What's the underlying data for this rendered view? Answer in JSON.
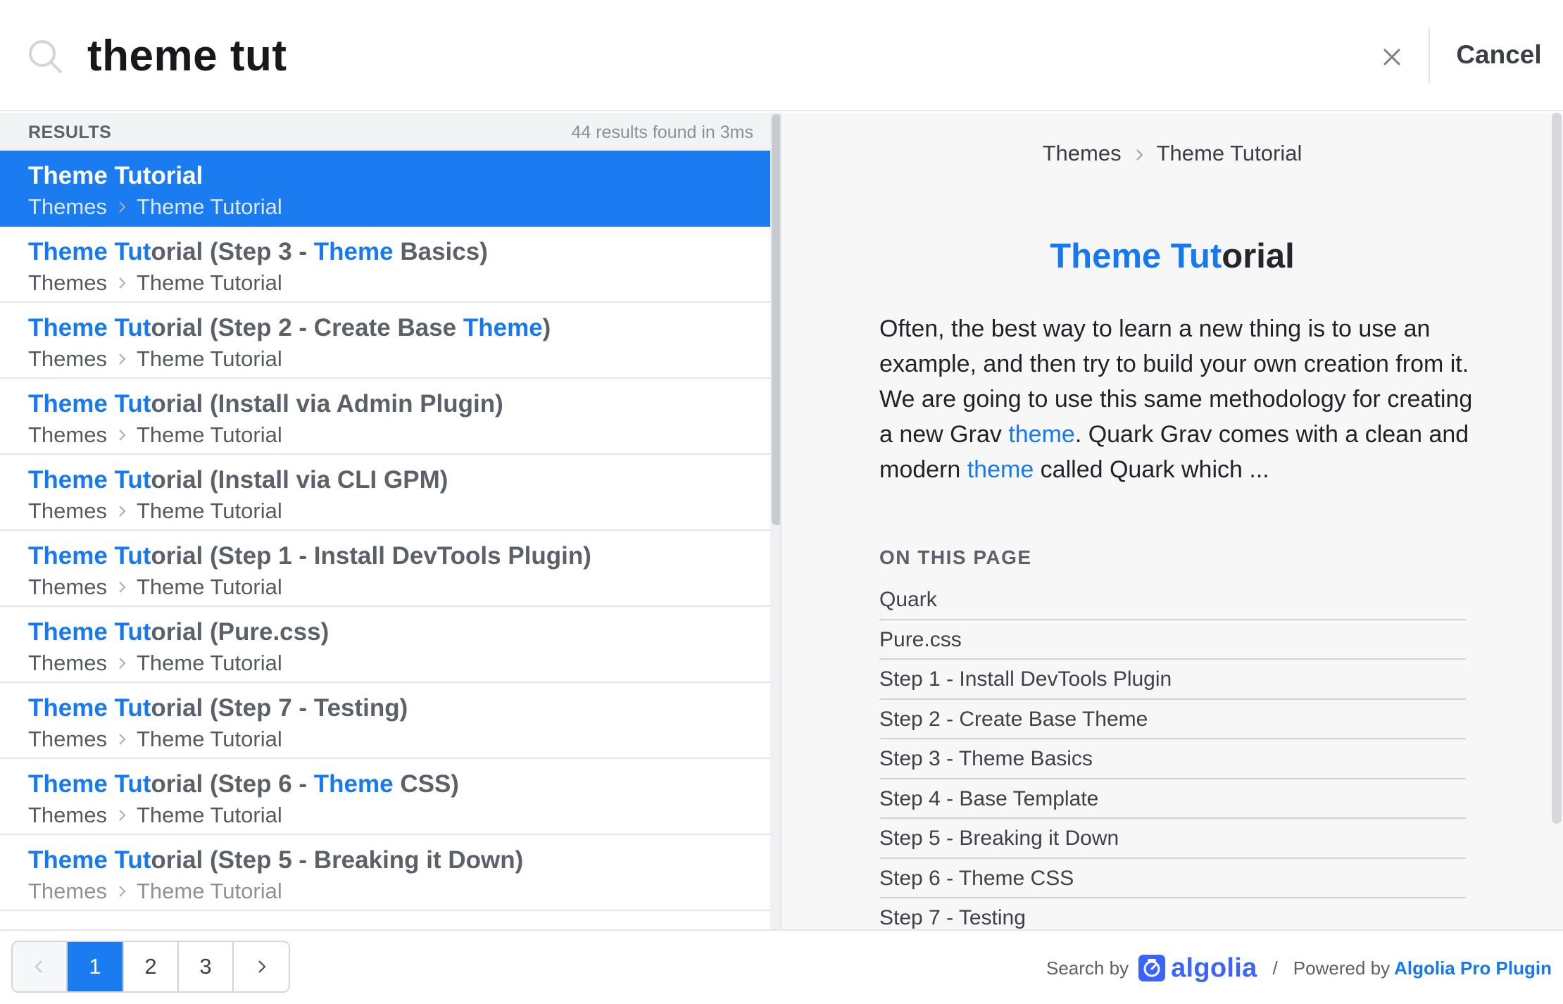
{
  "search": {
    "query": "theme tut",
    "cancel_label": "Cancel"
  },
  "results": {
    "header_label": "RESULTS",
    "meta": "44 results found in 3ms",
    "items": [
      {
        "title_hl": "Theme Tut",
        "title_rest": "orial",
        "title_tail": [],
        "crumb_1": "Themes",
        "crumb_2": "Theme Tutorial"
      },
      {
        "title_hl": "Theme Tut",
        "title_rest": "orial (Step 3 - ",
        "title_tail": [
          {
            "text": "Theme",
            "hl": true
          },
          {
            "text": " Basics)",
            "hl": false
          }
        ],
        "crumb_1": "Themes",
        "crumb_2": "Theme Tutorial"
      },
      {
        "title_hl": "Theme Tut",
        "title_rest": "orial (Step 2 - Create Base ",
        "title_tail": [
          {
            "text": "Theme",
            "hl": true
          },
          {
            "text": ")",
            "hl": false
          }
        ],
        "crumb_1": "Themes",
        "crumb_2": "Theme Tutorial"
      },
      {
        "title_hl": "Theme Tut",
        "title_rest": "orial (Install via Admin Plugin)",
        "title_tail": [],
        "crumb_1": "Themes",
        "crumb_2": "Theme Tutorial"
      },
      {
        "title_hl": "Theme Tut",
        "title_rest": "orial (Install via CLI GPM)",
        "title_tail": [],
        "crumb_1": "Themes",
        "crumb_2": "Theme Tutorial"
      },
      {
        "title_hl": "Theme Tut",
        "title_rest": "orial (Step 1 - Install DevTools Plugin)",
        "title_tail": [],
        "crumb_1": "Themes",
        "crumb_2": "Theme Tutorial"
      },
      {
        "title_hl": "Theme Tut",
        "title_rest": "orial (Pure.css)",
        "title_tail": [],
        "crumb_1": "Themes",
        "crumb_2": "Theme Tutorial"
      },
      {
        "title_hl": "Theme Tut",
        "title_rest": "orial (Step 7 - Testing)",
        "title_tail": [],
        "crumb_1": "Themes",
        "crumb_2": "Theme Tutorial"
      },
      {
        "title_hl": "Theme Tut",
        "title_rest": "orial (Step 6 - ",
        "title_tail": [
          {
            "text": "Theme",
            "hl": true
          },
          {
            "text": " CSS)",
            "hl": false
          }
        ],
        "crumb_1": "Themes",
        "crumb_2": "Theme Tutorial"
      },
      {
        "title_hl": "Theme Tut",
        "title_rest": "orial (Step 5 - Breaking it Down)",
        "title_tail": [],
        "crumb_1": "Themes",
        "crumb_2": "Theme Tutorial"
      }
    ]
  },
  "preview": {
    "crumb_1": "Themes",
    "crumb_2": "Theme Tutorial",
    "title_hl": "Theme Tut",
    "title_rest": "orial",
    "desc_1": "Often, the best way to learn a new thing is to use an example, and then try to build your own creation from it. We are going to use this same methodology for creating a new Grav ",
    "desc_link_1": "theme",
    "desc_2": ". Quark Grav comes with a clean and modern ",
    "desc_link_2": "theme",
    "desc_3": " called Quark which ...",
    "toc_title": "ON THIS PAGE",
    "toc": [
      "Quark",
      "Pure.css",
      "Step 1 - Install DevTools Plugin",
      "Step 2 - Create Base Theme",
      "Step 3 - Theme Basics",
      "Step 4 - Base Template",
      "Step 5 - Breaking it Down",
      "Step 6 - Theme CSS",
      "Step 7 - Testing"
    ]
  },
  "pagination": {
    "pages": [
      "1",
      "2",
      "3"
    ],
    "current": "1"
  },
  "footer": {
    "search_by": "Search by",
    "algolia": "algolia",
    "slash": "/",
    "powered_by": "Powered by",
    "plugin": "Algolia Pro Plugin"
  },
  "colors": {
    "accent": "#1a7cf0",
    "highlight_text": "#1679f0",
    "algolia_brand": "#3a63ff"
  },
  "icons": {
    "search": "search-icon",
    "clear": "close-icon",
    "crumb_separator": "chevron-right-icon",
    "prev_page": "chevron-left-icon",
    "next_page": "chevron-right-icon",
    "algolia": "algolia-logo-icon"
  }
}
